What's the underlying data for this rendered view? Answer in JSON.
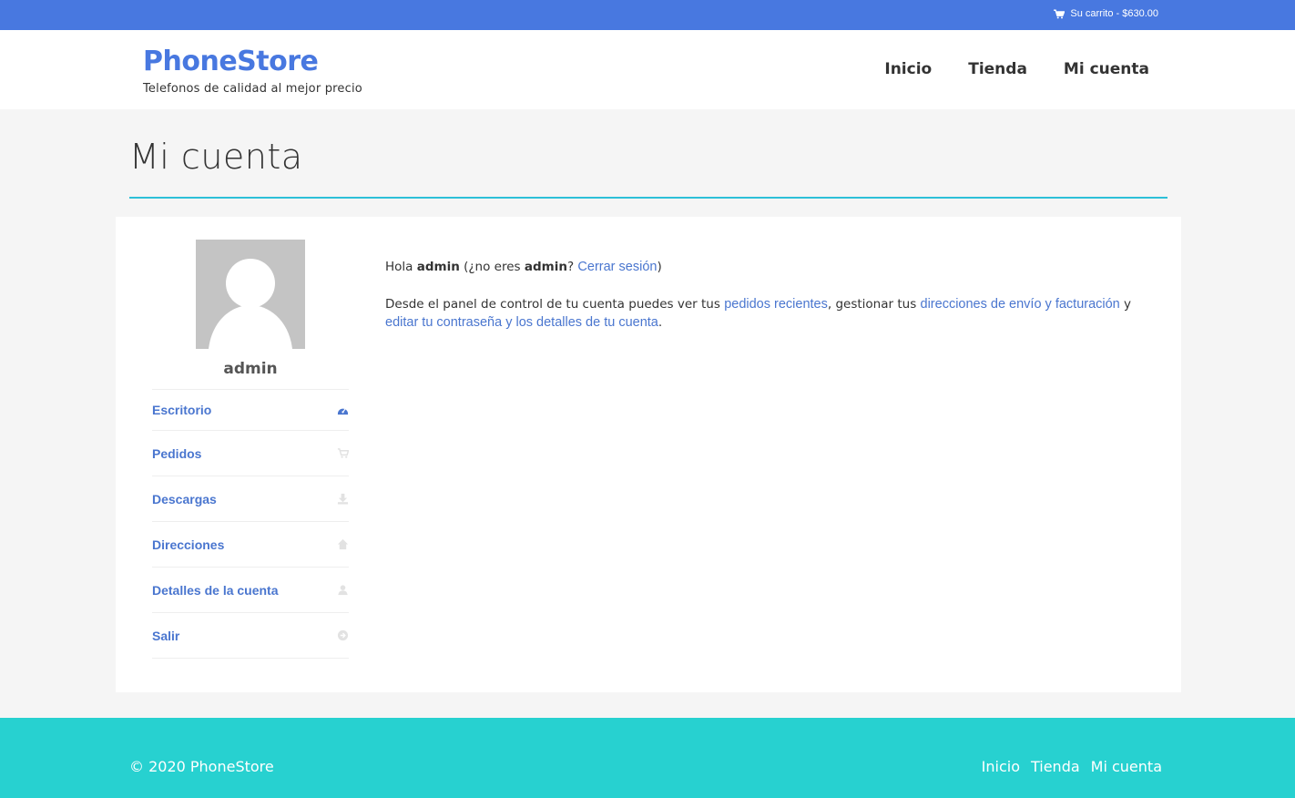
{
  "topbar": {
    "cart_label": "Su carrito - $630.00",
    "cart_icon": "cart-icon",
    "color": "#4878e0"
  },
  "header": {
    "brand_name": "PhoneStore",
    "tagline": "Telefonos de calidad al mejor precio",
    "nav": [
      "Inicio",
      "Tienda",
      "Mi cuenta"
    ]
  },
  "page": {
    "title": "Mi cuenta"
  },
  "account": {
    "username": "admin",
    "menu": [
      {
        "label": "Escritorio",
        "icon": "dashboard-icon",
        "active": true
      },
      {
        "label": "Pedidos",
        "icon": "cart-icon",
        "active": false
      },
      {
        "label": "Descargas",
        "icon": "download-icon",
        "active": false
      },
      {
        "label": "Direcciones",
        "icon": "home-icon",
        "active": false
      },
      {
        "label": "Detalles de la cuenta",
        "icon": "user-icon",
        "active": false
      },
      {
        "label": "Salir",
        "icon": "logout-icon",
        "active": false
      }
    ]
  },
  "dashboard": {
    "greeting_prefix": "Hola ",
    "user": "admin",
    "not_you_prefix": " (¿no eres ",
    "not_you_suffix": "? ",
    "logout_link": "Cerrar sesión",
    "close_paren": ")",
    "intro": "Desde el panel de control de tu cuenta puedes ver tus ",
    "orders_link": "pedidos recientes",
    "mid": ", gestionar tus ",
    "addresses_link": "direcciones de envío y facturación",
    "and": " y ",
    "edit_link": "editar tu contraseña y los detalles de tu cuenta",
    "end": "."
  },
  "footer": {
    "copyright": "© 2020 PhoneStore",
    "nav": [
      "Inicio",
      "Tienda",
      "Mi cuenta"
    ],
    "color": "#27d1d0"
  }
}
